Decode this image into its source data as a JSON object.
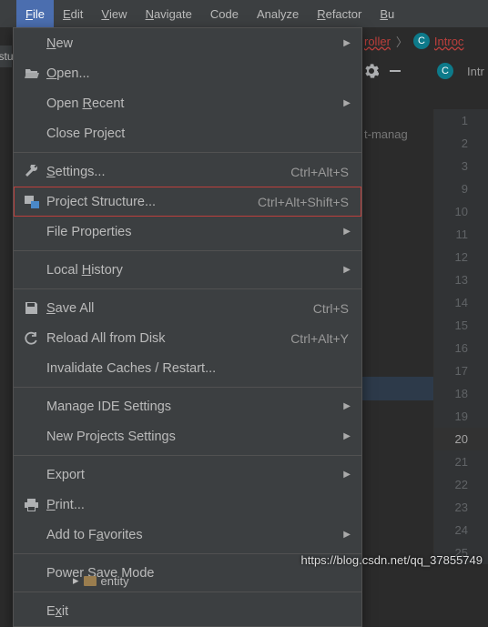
{
  "menubar": {
    "items": [
      {
        "label": "File",
        "u": "F",
        "rest": "ile",
        "active": true
      },
      {
        "label": "Edit",
        "u": "E",
        "rest": "dit"
      },
      {
        "label": "View",
        "u": "V",
        "rest": "iew"
      },
      {
        "label": "Navigate",
        "u": "N",
        "rest": "avigate"
      },
      {
        "label": "Code",
        "u": "",
        "rest": "Code"
      },
      {
        "label": "Analyze",
        "u": "",
        "rest": "Analyze"
      },
      {
        "label": "Refactor",
        "u": "R",
        "rest": "efactor"
      },
      {
        "label": "Bu",
        "u": "B",
        "rest": "u"
      }
    ]
  },
  "breadcrumb": {
    "roller": "roller",
    "class_prefix": "C",
    "class_name": "Introc"
  },
  "toolbar": {
    "tab_prefix": "C",
    "tab_name": "Intr",
    "bg_text": "t-manag"
  },
  "gutter": {
    "lines": [
      1,
      2,
      3,
      9,
      10,
      11,
      12,
      13,
      14,
      15,
      16,
      17,
      18,
      19,
      20,
      21,
      22,
      23,
      24,
      25
    ],
    "active": 20
  },
  "file_menu": {
    "new": "New",
    "open": "Open...",
    "open_recent": "Open Recent",
    "close_project": "Close Project",
    "settings": "Settings...",
    "settings_sc": "Ctrl+Alt+S",
    "project_structure": "Project Structure...",
    "project_structure_sc": "Ctrl+Alt+Shift+S",
    "file_properties": "File Properties",
    "local_history": "Local History",
    "save_all": "Save All",
    "save_all_sc": "Ctrl+S",
    "reload": "Reload All from Disk",
    "reload_sc": "Ctrl+Alt+Y",
    "invalidate": "Invalidate Caches / Restart...",
    "manage_ide": "Manage IDE Settings",
    "new_projects_settings": "New Projects Settings",
    "export": "Export",
    "print": "Print...",
    "add_fav": "Add to Favorites",
    "power_save": "Power Save Mode",
    "exit": "Exit"
  },
  "left_stub": "stu",
  "tree": {
    "arrow": "▸",
    "folder": "entity"
  },
  "watermark": "https://blog.csdn.net/qq_37855749"
}
